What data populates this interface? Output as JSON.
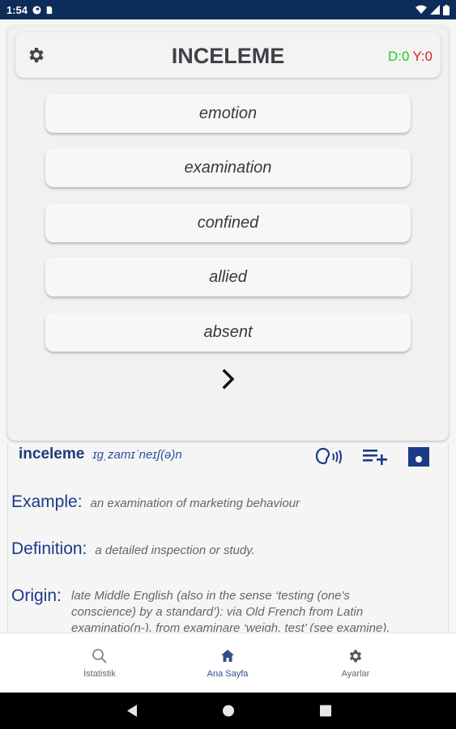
{
  "status_bar": {
    "time": "1:54"
  },
  "header": {
    "title": "INCELEME",
    "score_d": "D:0",
    "score_y": "Y:0"
  },
  "options": [
    {
      "label": "emotion"
    },
    {
      "label": "examination"
    },
    {
      "label": "confined"
    },
    {
      "label": "allied"
    },
    {
      "label": "absent"
    }
  ],
  "word": {
    "text": "inceleme",
    "ipa": "ɪɡˌzamɪˈneɪʃ(ə)n"
  },
  "details": {
    "example_label": "Example:",
    "example_value": "an examination of marketing behaviour",
    "definition_label": "Definition:",
    "definition_value": "a detailed inspection or study.",
    "origin_label": "Origin:",
    "origin_value": "late Middle English (also in the sense ‘testing (one's conscience) by a standard’): via Old French from Latin examinatio(n-), from examinare ‘weigh, test’ (see examine)."
  },
  "bottom_nav": [
    {
      "label": "İstatistik",
      "icon": "search-icon"
    },
    {
      "label": "Ana Sayfa",
      "icon": "home-icon"
    },
    {
      "label": "Ayarlar",
      "icon": "gear-icon"
    }
  ],
  "colors": {
    "accent": "#1b3a88",
    "correct": "#1ad11a",
    "wrong": "#e02020",
    "status_bar": "#0d2c5a"
  }
}
